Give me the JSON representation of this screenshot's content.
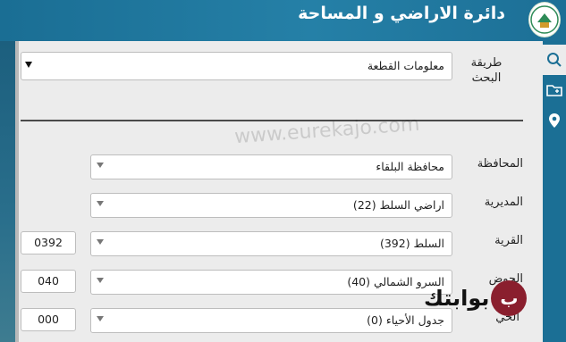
{
  "header": {
    "title": "دائرة الاراضي و المساحة"
  },
  "sidebar": {
    "icons": [
      "search-icon",
      "folder-icon",
      "location-pin-icon"
    ]
  },
  "search": {
    "method_label": "طريقة البحث",
    "method_value": "معلومات القطعة"
  },
  "form": {
    "governorate": {
      "label": "المحافظة",
      "value": "محافظة البلقاء"
    },
    "directorate": {
      "label": "المديرية",
      "value": "اراضي السلط (22)"
    },
    "village": {
      "label": "القرية",
      "value": "السلط (392)",
      "code": "0392"
    },
    "basin": {
      "label": "الحوض",
      "value": "السرو الشمالي (40)",
      "code": "040"
    },
    "neighborhood": {
      "label": "الحي",
      "value": "جدول الأحياء (0)",
      "code": "000"
    }
  },
  "overlay": {
    "watermark": "www.eurekajo.com",
    "brand": "بوابتك"
  },
  "colors": {
    "header_bg": "#1b6f95",
    "panel_bg": "#ececec",
    "brand_mark": "#8a1f2e"
  }
}
